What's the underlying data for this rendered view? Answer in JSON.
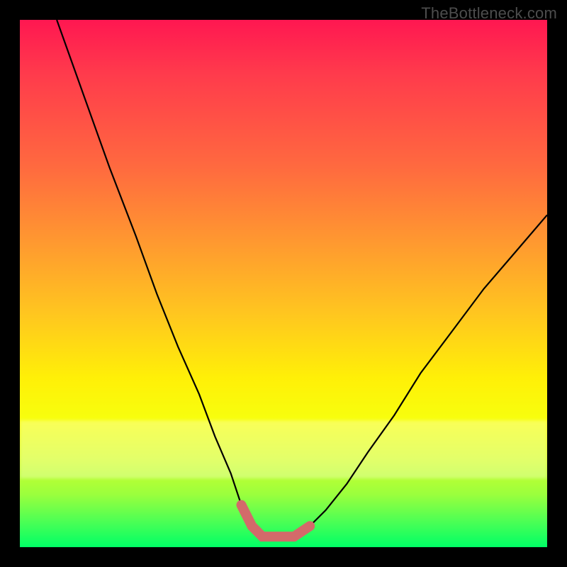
{
  "watermark": "TheBottleneck.com",
  "chart_data": {
    "type": "line",
    "title": "",
    "xlabel": "",
    "ylabel": "",
    "xlim": [
      0,
      100
    ],
    "ylim": [
      0,
      100
    ],
    "grid": false,
    "legend": false,
    "series": [
      {
        "name": "bottleneck-curve",
        "color": "#000000",
        "x": [
          7,
          12,
          17,
          22,
          26,
          30,
          34,
          37,
          40,
          42,
          44,
          46,
          49,
          52,
          55,
          58,
          62,
          66,
          71,
          76,
          82,
          88,
          94,
          100
        ],
        "y": [
          100,
          86,
          72,
          59,
          48,
          38,
          29,
          21,
          14,
          8,
          4,
          2,
          2,
          2,
          4,
          7,
          12,
          18,
          25,
          33,
          41,
          49,
          56,
          63
        ]
      }
    ],
    "annotations": [
      {
        "name": "optimal-range",
        "type": "highlight-segment",
        "color": "#d36a6a",
        "x_start": 42,
        "x_end": 55
      }
    ],
    "gradient_stops": [
      {
        "pos": 0,
        "color": "#ff1751"
      },
      {
        "pos": 28,
        "color": "#ff6a3f"
      },
      {
        "pos": 56,
        "color": "#ffc71f"
      },
      {
        "pos": 76,
        "color": "#f7ff0e"
      },
      {
        "pos": 100,
        "color": "#00ff66"
      }
    ]
  }
}
